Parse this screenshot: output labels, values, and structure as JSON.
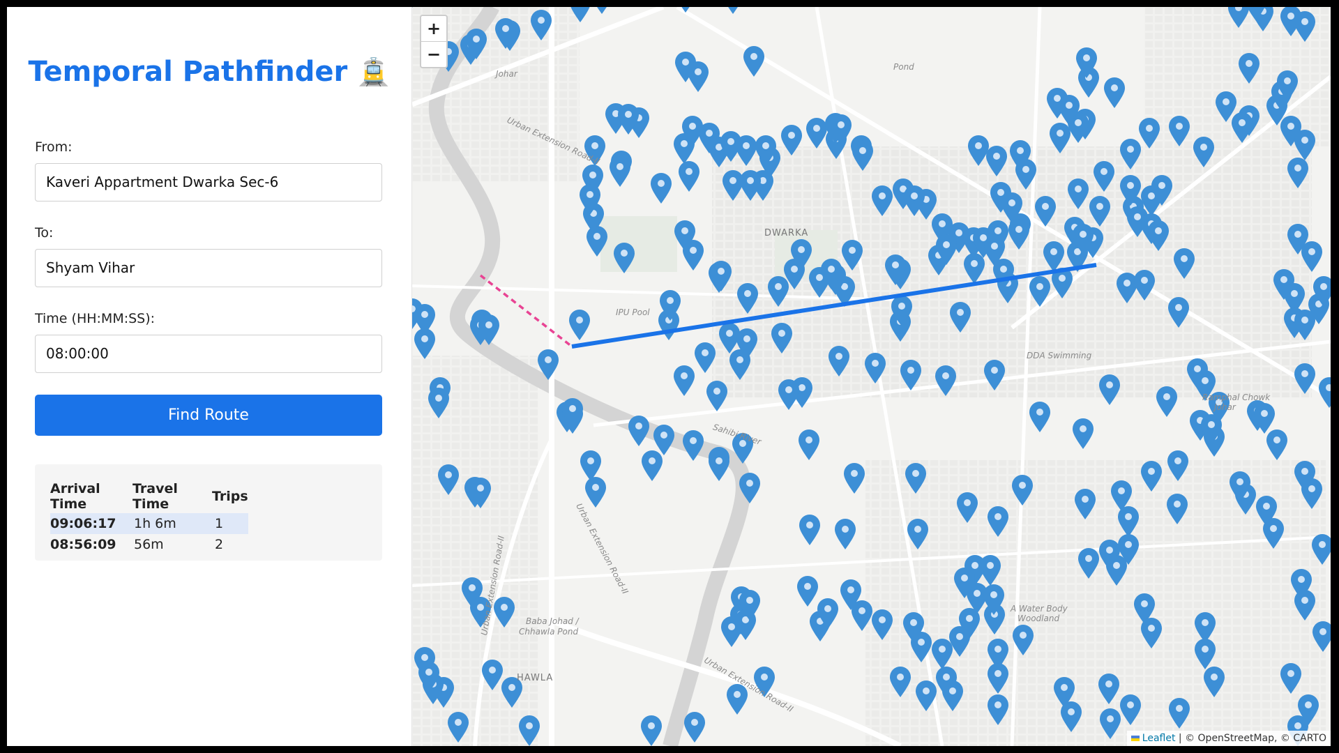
{
  "app": {
    "title": "Temporal Pathfinder",
    "title_emoji": "🚊"
  },
  "form": {
    "from_label": "From:",
    "from_value": "Kaveri Appartment Dwarka Sec-6",
    "to_label": "To:",
    "to_value": "Shyam Vihar",
    "time_label": "Time (HH:MM:SS):",
    "time_value": "08:00:00",
    "find_button": "Find Route"
  },
  "results": {
    "headers": [
      "Arrival Time",
      "Travel Time",
      "Trips"
    ],
    "rows": [
      {
        "arrival": "09:06:17",
        "travel": "1h 6m",
        "trips": "1"
      },
      {
        "arrival": "08:56:09",
        "travel": "56m",
        "trips": "2"
      }
    ]
  },
  "map": {
    "zoom_in": "+",
    "zoom_out": "−",
    "attribution_leaflet": "Leaflet",
    "attribution_rest": "| © OpenStreetMap, © CARTO",
    "labels": {
      "dwarka": "DWARKA",
      "ipu_pool": "IPU Pool",
      "dda_swimming": "DDA Swimming",
      "ramphal_chowk": "Ramphal Chowk",
      "johar_1": "Johar",
      "pond": "Pond",
      "johar_2": "Johar",
      "sahibi_river": "Sahibi River",
      "baba_johad": "Baba Johad /",
      "chhawla_pond": "Chhawla Pond",
      "chhawla": "HAWLA",
      "water_body": "A Water Body",
      "woodland": "Woodland",
      "urban_ext_1": "Urban Extension Road-II",
      "urban_ext_2": "Urban Extension Road-II",
      "urban_ext_3": "Urban Extension Road-II",
      "urban_ext_4": "Urban Extension Road-II"
    },
    "colors": {
      "route": "#1a73e8",
      "walk": "#e84393",
      "marker": "#3d8fd6"
    }
  }
}
